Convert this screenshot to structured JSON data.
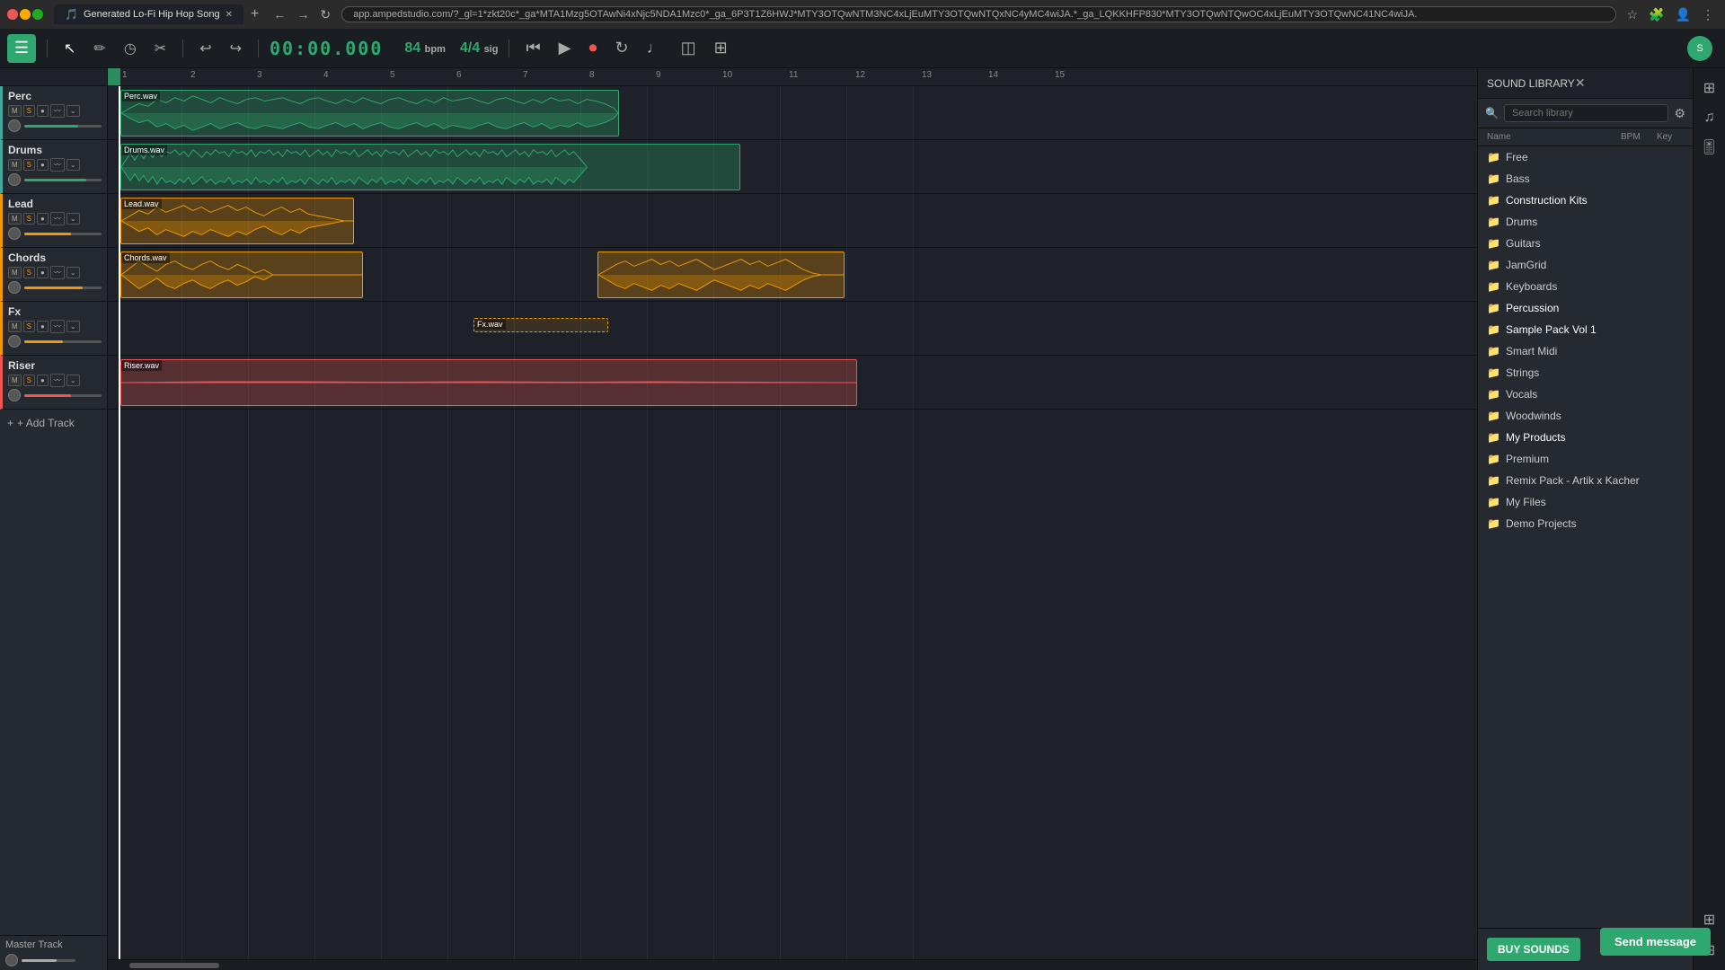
{
  "browser": {
    "tab_title": "Generated Lo-Fi Hip Hop Song",
    "url": "app.ampedstudio.com/?_gl=1*zkt20c*_ga*MTA1Mzg5OTAwNi4xNjc5NDA1Mzc0*_ga_6P3T1Z6HWJ*MTY3OTQwNTM3NC4xLjEuMTY3OTQwNTQxNC4yMC4wiJA.*_ga_LQKKHFP830*MTY3OTQwNTQwOC4xLjEuMTY3OTQwNC41NC4wiJA."
  },
  "app": {
    "title": "Generated Lo-Fi Hip Hop Song",
    "time": "00:00.000",
    "bpm": "84",
    "bpm_label": "bpm",
    "time_sig": "4/4",
    "time_sig_label": "sig"
  },
  "tracks": [
    {
      "id": "perc",
      "name": "Perc",
      "clip_file": "Perc.wav",
      "color": "green"
    },
    {
      "id": "drums",
      "name": "Drums",
      "clip_file": "Drums.wav",
      "color": "green"
    },
    {
      "id": "lead",
      "name": "Lead",
      "clip_file": "Lead.wav",
      "color": "yellow"
    },
    {
      "id": "chords",
      "name": "Chords",
      "clip_file": "Chords.wav",
      "color": "yellow"
    },
    {
      "id": "fx",
      "name": "Fx",
      "clip_file": "Fx.wav",
      "color": "yellow"
    },
    {
      "id": "riser",
      "name": "Riser",
      "clip_file": "Riser.wav",
      "color": "red"
    }
  ],
  "buttons": {
    "add_track": "+ Add Track",
    "master_track": "Master Track",
    "buy_sounds": "BUY SOUNDS",
    "send_message": "Send message"
  },
  "library": {
    "title": "SOUND LIBRARY",
    "search_placeholder": "Search library",
    "col_name": "Name",
    "col_bpm": "BPM",
    "col_key": "Key",
    "items": [
      {
        "name": "Free",
        "type": "folder"
      },
      {
        "name": "Bass",
        "type": "folder"
      },
      {
        "name": "Construction Kits",
        "type": "folder",
        "highlighted": true
      },
      {
        "name": "Drums",
        "type": "folder"
      },
      {
        "name": "Guitars",
        "type": "folder"
      },
      {
        "name": "JamGrid",
        "type": "folder"
      },
      {
        "name": "Keyboards",
        "type": "folder"
      },
      {
        "name": "Percussion",
        "type": "folder",
        "highlighted": true
      },
      {
        "name": "Sample Pack Vol 1",
        "type": "folder",
        "highlighted": true
      },
      {
        "name": "Smart Midi",
        "type": "folder"
      },
      {
        "name": "Strings",
        "type": "folder"
      },
      {
        "name": "Vocals",
        "type": "folder"
      },
      {
        "name": "Woodwinds",
        "type": "folder"
      },
      {
        "name": "My Products",
        "type": "folder",
        "highlighted": true
      },
      {
        "name": "Premium",
        "type": "folder"
      },
      {
        "name": "Remix Pack - Artik x Kacher",
        "type": "folder"
      },
      {
        "name": "My Files",
        "type": "folder"
      },
      {
        "name": "Demo Projects",
        "type": "folder"
      }
    ]
  }
}
